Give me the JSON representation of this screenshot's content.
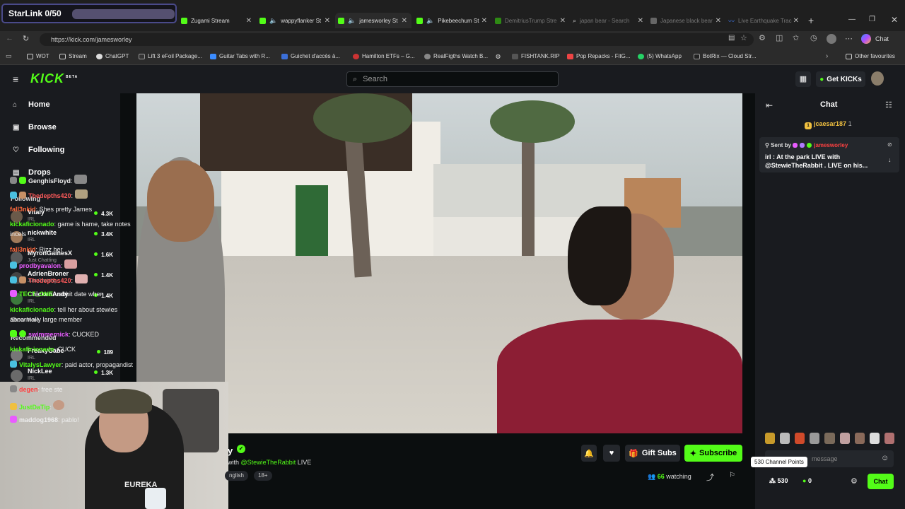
{
  "overlay": {
    "starlink": "StarLink 0/50"
  },
  "tabs": [
    {
      "label": "Zugami Stream",
      "color": "#53fc18",
      "left": 0
    },
    {
      "label": "wappyflanker St",
      "color": "#53fc18"
    },
    {
      "label": "jamesworley St",
      "color": "#53fc18"
    },
    {
      "label": "Pikebeechum St",
      "color": "#53fc18"
    },
    {
      "label": "DemitriusTrump Stre",
      "color": "#53fc18"
    },
    {
      "label": "japan bear - Search",
      "color": "#888888"
    },
    {
      "label": "Japanese black bear",
      "color": "#888888"
    },
    {
      "label": "Live Earthquake Trac",
      "color": "#3b6fd8"
    }
  ],
  "browser": {
    "url": "https://kick.com/jamesworley",
    "profile": "Chat"
  },
  "bookmarks": [
    "WOT",
    "Stream",
    "ChatGPT",
    "Lift 3 eFoil Package...",
    "Guitar Tabs with R...",
    "Guichet d'accès à...",
    "Hamilton ETFs – G...",
    "RealFigths Watch B...",
    "FISHTANK.RIP",
    "Pop Repacks - FitG...",
    "(5) WhatsApp",
    "BotRix — Cloud Str..."
  ],
  "bookmarks_other": "Other favourites",
  "kick": {
    "logo": "KICK",
    "logo_beta": "BETA",
    "search_placeholder": "Search",
    "get_kicks": "Get KICKs"
  },
  "nav": {
    "home": "Home",
    "browse": "Browse",
    "following": "Following",
    "drops": "Drops"
  },
  "following_title": "Following",
  "following": [
    {
      "name": "Vitaly",
      "cat": "IRL",
      "viewers": "4.3K"
    },
    {
      "name": "nickwhite",
      "cat": "IRL",
      "viewers": "3.4K"
    },
    {
      "name": "MyronGainesX",
      "cat": "Just Chatting",
      "viewers": "1.6K"
    },
    {
      "name": "AdrienBroner",
      "cat": "Just Chatting",
      "viewers": "1.4K"
    },
    {
      "name": "ChickenAndy",
      "cat": "IRL",
      "viewers": "1.4K"
    }
  ],
  "show_more": "Show More",
  "recommended_title": "Recommended",
  "recommended": [
    {
      "name": "FreakyGabe",
      "cat": "IRL",
      "viewers": "189"
    },
    {
      "name": "NickLee",
      "cat": "IRL",
      "viewers": "1.3K"
    }
  ],
  "stream": {
    "title_tail": "y",
    "with_label": "with",
    "with_user": "@StewieTheRabbit",
    "live": "LIVE",
    "lang": "nglish",
    "age": "18+",
    "watching_count": "66",
    "watching_label": "watching",
    "gift_subs": "Gift Subs",
    "subscribe": "Subscribe"
  },
  "chat": {
    "title": "Chat",
    "top_user": "jcaesar187",
    "top_count": "1",
    "pinned_sent_by": "Sent by",
    "pinned_user": "jamesworley",
    "pinned_text": "irl : At the park LIVE with @StewieTheRabbit . LIVE on his...",
    "messages": [
      {
        "user": "GenghisFloyd",
        "text": "",
        "color": "#ffffff"
      },
      {
        "user": "Thedepths420",
        "text": "",
        "color": "#ff5a5a"
      },
      {
        "user": "fall3nkid",
        "text": "Shes pretty James",
        "color": "#ff6a3d"
      },
      {
        "user": "kickaficionado",
        "text": "game is hame, take notes incels",
        "color": "#53fc18"
      },
      {
        "user": "fall3nkid",
        "text": "Rizz her",
        "color": "#ff6a3d"
      },
      {
        "user": "prodbyavalon",
        "text": "",
        "color": "#e95cff"
      },
      {
        "user": "Thedepths420",
        "text": "",
        "color": "#ff5a5a"
      },
      {
        "user": "TECT_ONE",
        "text": "rabbit date when",
        "color": "#53fc18"
      },
      {
        "user": "kickaficionado",
        "text": "tell her about stewies abnormally large member",
        "color": "#53fc18"
      },
      {
        "user": "swimmernick",
        "text": "CUCKED",
        "color": "#e95cff"
      },
      {
        "user": "kickaficionado",
        "text": "CUCK",
        "color": "#53fc18"
      },
      {
        "user": "VitalysLawyer",
        "text": "paid actor, propagandist",
        "color": "#53fc18"
      },
      {
        "user": "degen",
        "text": "free ste",
        "color": "#ff4040"
      },
      {
        "user": "JustDaTip",
        "text": "",
        "color": "#53fc18"
      },
      {
        "user": "maddog1968",
        "text": "pablo!",
        "color": "#ffffff"
      }
    ],
    "tooltip": "530 Channel Points",
    "input_placeholder": "message",
    "points": "530",
    "kicks": "0",
    "send": "Chat"
  }
}
